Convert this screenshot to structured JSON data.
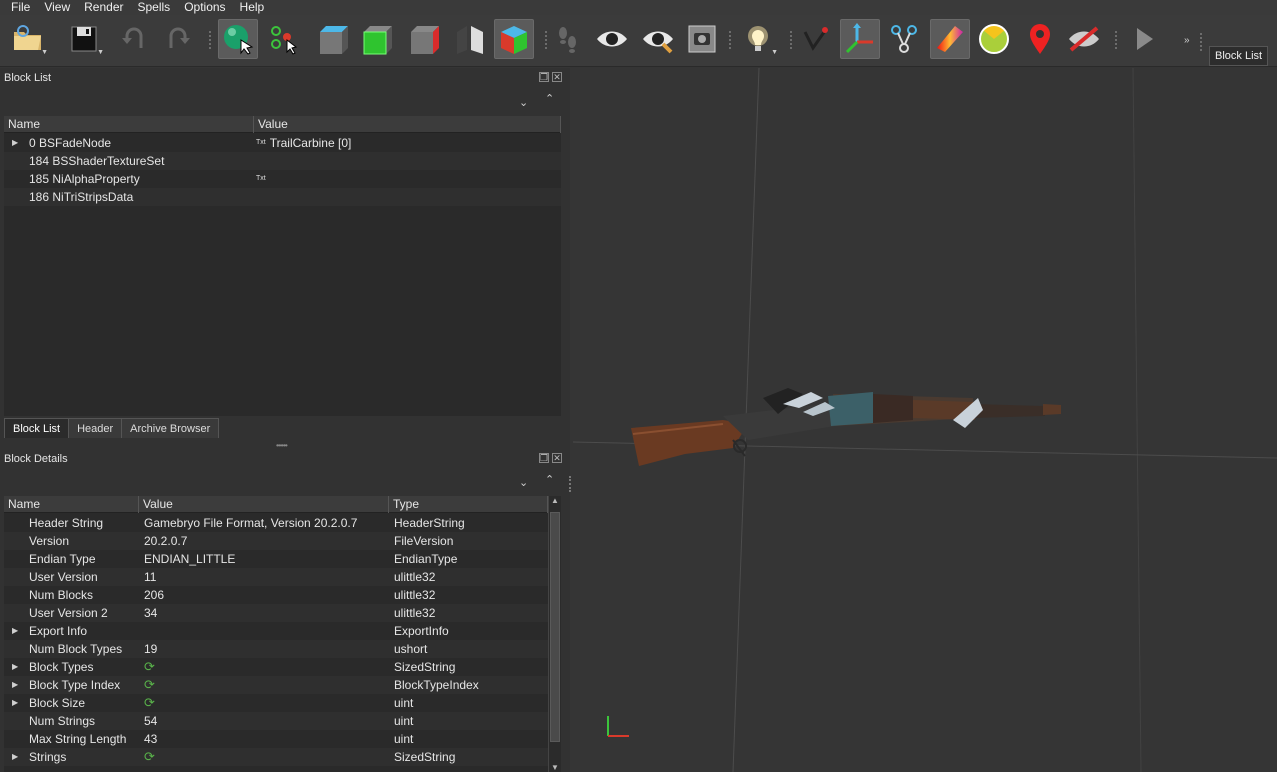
{
  "menu": [
    "File",
    "View",
    "Render",
    "Spells",
    "Options",
    "Help"
  ],
  "toolbar": {
    "icons": [
      "open-file-icon",
      "save-icon",
      "undo-icon",
      "redo-icon",
      "select-object-icon",
      "select-vertex-icon",
      "view-front-icon",
      "view-top-icon",
      "view-side-icon",
      "view-flip-icon",
      "view-perspective-icon",
      "walk-mode-icon",
      "show-hidden-icon",
      "show-hidden-alt-icon",
      "screenshot-icon",
      "lighting-icon",
      "normals-icon",
      "axes-icon",
      "nodes-icon",
      "texture-icon",
      "vertex-colors-icon",
      "collision-icon",
      "markers-icon",
      "hide-icon",
      "play-icon"
    ],
    "more": "»",
    "block_list_button": "Block List"
  },
  "block_list": {
    "title": "Block List",
    "columns": [
      "Name",
      "Value"
    ],
    "rows": [
      {
        "name": "0 BSFadeNode",
        "value": "TrailCarbine [0]",
        "expandable": true,
        "txt_tag": "Txt"
      },
      {
        "name": "184 BSShaderTextureSet",
        "value": "",
        "expandable": false,
        "txt_tag": ""
      },
      {
        "name": "185 NiAlphaProperty",
        "value": "",
        "expandable": false,
        "txt_tag": "Txt"
      },
      {
        "name": "186 NiTriStripsData",
        "value": "",
        "expandable": false,
        "txt_tag": ""
      }
    ],
    "tabs": [
      "Block List",
      "Header",
      "Archive Browser"
    ],
    "active_tab": "Block List"
  },
  "block_details": {
    "title": "Block Details",
    "columns": [
      "Name",
      "Value",
      "Type"
    ],
    "rows": [
      {
        "name": "Header String",
        "value": "Gamebryo File Format, Version 20.2.0.7",
        "type": "HeaderString",
        "expandable": false,
        "icon": false
      },
      {
        "name": "Version",
        "value": "20.2.0.7",
        "type": "FileVersion",
        "expandable": false,
        "icon": false
      },
      {
        "name": "Endian Type",
        "value": "ENDIAN_LITTLE",
        "type": "EndianType",
        "expandable": false,
        "icon": false
      },
      {
        "name": "User Version",
        "value": "11",
        "type": "ulittle32",
        "expandable": false,
        "icon": false
      },
      {
        "name": "Num Blocks",
        "value": "206",
        "type": "ulittle32",
        "expandable": false,
        "icon": false
      },
      {
        "name": "User Version 2",
        "value": "34",
        "type": "ulittle32",
        "expandable": false,
        "icon": false
      },
      {
        "name": "Export Info",
        "value": "",
        "type": "ExportInfo",
        "expandable": true,
        "icon": false
      },
      {
        "name": "Num Block Types",
        "value": "19",
        "type": "ushort",
        "expandable": false,
        "icon": false
      },
      {
        "name": "Block Types",
        "value": "",
        "type": "SizedString",
        "expandable": true,
        "icon": true
      },
      {
        "name": "Block Type Index",
        "value": "",
        "type": "BlockTypeIndex",
        "expandable": true,
        "icon": true
      },
      {
        "name": "Block Size",
        "value": "",
        "type": "uint",
        "expandable": true,
        "icon": true
      },
      {
        "name": "Num Strings",
        "value": "54",
        "type": "uint",
        "expandable": false,
        "icon": false
      },
      {
        "name": "Max String Length",
        "value": "43",
        "type": "uint",
        "expandable": false,
        "icon": false
      },
      {
        "name": "Strings",
        "value": "",
        "type": "SizedString",
        "expandable": true,
        "icon": true
      }
    ]
  },
  "colors": {
    "accent": "#5b5b5b",
    "panel": "#2a2a2a",
    "axis_x": "#d93a2b",
    "axis_y": "#3cc43c"
  }
}
